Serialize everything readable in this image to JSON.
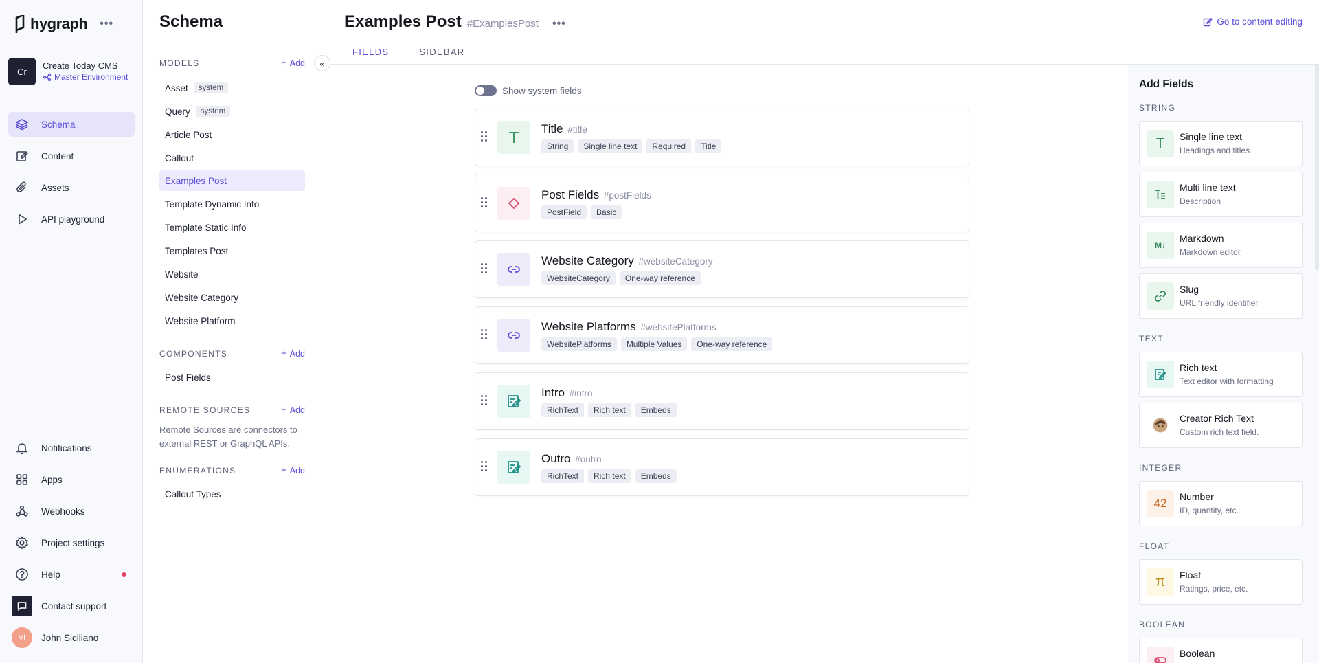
{
  "brand": {
    "name": "hygraph"
  },
  "project": {
    "initials": "Cr",
    "name": "Create Today CMS",
    "environment": "Master Environment"
  },
  "nav": {
    "schema": "Schema",
    "content": "Content",
    "assets": "Assets",
    "api_playground": "API playground",
    "notifications": "Notifications",
    "apps": "Apps",
    "webhooks": "Webhooks",
    "project_settings": "Project settings",
    "help": "Help",
    "contact_support": "Contact support"
  },
  "user": {
    "initials": "VI",
    "name": "John Siciliano"
  },
  "schema_panel": {
    "title": "Schema",
    "add_label": "Add",
    "models_label": "MODELS",
    "system_tag": "system",
    "models": [
      "Asset",
      "Query",
      "Article Post",
      "Callout",
      "Examples Post",
      "Template Dynamic Info",
      "Template Static Info",
      "Templates Post",
      "Website",
      "Website Category",
      "Website Platform"
    ],
    "components_label": "COMPONENTS",
    "components": [
      "Post Fields"
    ],
    "remote_label": "REMOTE SOURCES",
    "remote_desc": "Remote Sources are connectors to external REST or GraphQL APIs.",
    "enums_label": "ENUMERATIONS",
    "enums": [
      "Callout Types"
    ]
  },
  "main": {
    "title": "Examples Post",
    "api_id": "#ExamplesPost",
    "go_content": "Go to content editing",
    "tabs": [
      "FIELDS",
      "SIDEBAR"
    ],
    "show_system": "Show system fields",
    "fields": [
      {
        "name": "Title",
        "api": "#title",
        "tags": [
          "String",
          "Single line text",
          "Required",
          "Title"
        ],
        "icon": "text-t-icon"
      },
      {
        "name": "Post Fields",
        "api": "#postFields",
        "tags": [
          "PostField",
          "Basic"
        ],
        "icon": "component-icon"
      },
      {
        "name": "Website Category",
        "api": "#websiteCategory",
        "tags": [
          "WebsiteCategory",
          "One-way reference"
        ],
        "icon": "link-icon"
      },
      {
        "name": "Website Platforms",
        "api": "#websitePlatforms",
        "tags": [
          "WebsitePlatforms",
          "Multiple Values",
          "One-way reference"
        ],
        "icon": "link-icon"
      },
      {
        "name": "Intro",
        "api": "#intro",
        "tags": [
          "RichText",
          "Rich text",
          "Embeds"
        ],
        "icon": "richtext-icon"
      },
      {
        "name": "Outro",
        "api": "#outro",
        "tags": [
          "RichText",
          "Rich text",
          "Embeds"
        ],
        "icon": "richtext-icon"
      }
    ]
  },
  "add_fields": {
    "title": "Add Fields",
    "sections": {
      "string": "STRING",
      "text": "TEXT",
      "integer": "INTEGER",
      "float": "FLOAT",
      "boolean": "BOOLEAN"
    },
    "types": [
      {
        "name": "Single line text",
        "desc": "Headings and titles"
      },
      {
        "name": "Multi line text",
        "desc": "Description"
      },
      {
        "name": "Markdown",
        "desc": "Markdown editor"
      },
      {
        "name": "Slug",
        "desc": "URL friendly identifier"
      },
      {
        "name": "Rich text",
        "desc": "Text editor with formatting"
      },
      {
        "name": "Creator Rich Text",
        "desc": "Custom rich text field."
      },
      {
        "name": "Number",
        "desc": "ID, quantity, etc."
      },
      {
        "name": "Float",
        "desc": "Ratings, price, etc."
      },
      {
        "name": "Boolean",
        "desc": ""
      }
    ],
    "glyphs": {
      "markdown": "M↓",
      "number": "42",
      "float": "π",
      "single": "T"
    }
  },
  "colors": {
    "accent": "#5b4fd6",
    "help_dot": "#e0426b"
  }
}
